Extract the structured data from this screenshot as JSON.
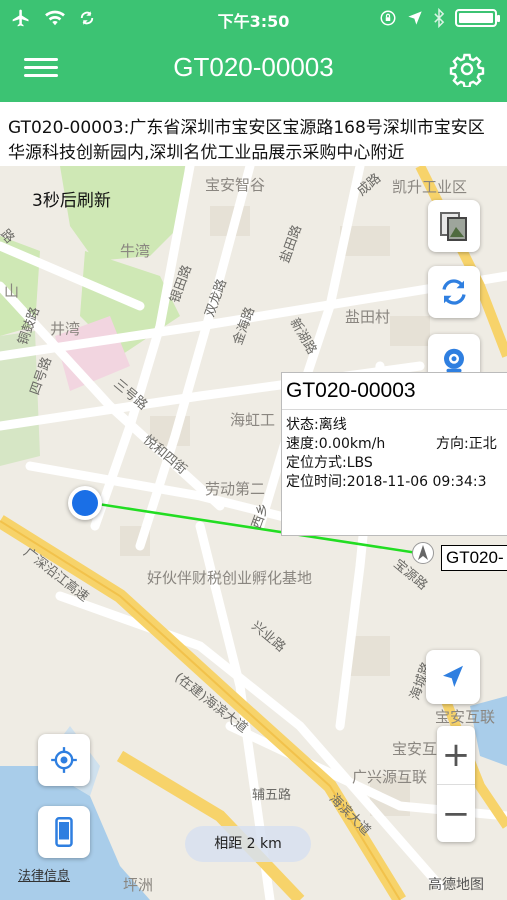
{
  "status_bar": {
    "time": "下午3:50"
  },
  "nav": {
    "title": "GT020-00003"
  },
  "address": {
    "text": "GT020-00003:广东省深圳市宝安区宝源路168号深圳市宝安区华源科技创新园内,深圳名优工业品展示采购中心附近"
  },
  "map": {
    "refresh_countdown": "3秒后刷新",
    "place_labels": [
      "宝安智谷",
      "凯升工业区",
      "牛湾",
      "盐田村",
      "井湾",
      "海虹工",
      "劳动第二",
      "好伙伴财税创业孵化基地",
      "宝安互联",
      "宝安互联",
      "广兴源互联",
      "坪洲",
      "山"
    ],
    "road_labels": [
      "银田路",
      "双龙路",
      "金海路",
      "新湖路",
      "三号路",
      "悦和四街",
      "西乡",
      "宝源路",
      "兴业路",
      "广深沿江高速",
      "(在建)海滨大道",
      "辅五路",
      "海滨大道",
      "铜鼓路",
      "四号路",
      "海城路",
      "盐田路",
      "成路",
      "路"
    ],
    "scale_text": "相距 2 km",
    "legal_link": "法律信息",
    "brand": "高德地图",
    "colors": {
      "route_line": "#22dd22",
      "current_location": "#1a6fe6",
      "accent": "#3cc373"
    }
  },
  "info_window": {
    "title": "GT020-00003",
    "status": "状态:离线",
    "speed": "速度:0.00km/h",
    "direction": "方向:正北",
    "positioning": "定位方式:LBS",
    "time": "定位时间:2018-11-06 09:34:3"
  },
  "device_tag": {
    "label": "GT020-"
  },
  "icons": [
    "airplane-icon",
    "wifi-icon",
    "refresh-icon",
    "lock-rotation-icon",
    "location-arrow-icon",
    "bluetooth-icon",
    "battery-icon",
    "menu-icon",
    "gear-icon",
    "map-layers-icon",
    "sync-icon",
    "street-view-icon",
    "navigation-arrow-icon",
    "locate-icon",
    "phone-icon",
    "zoom-in-icon",
    "zoom-out-icon"
  ]
}
